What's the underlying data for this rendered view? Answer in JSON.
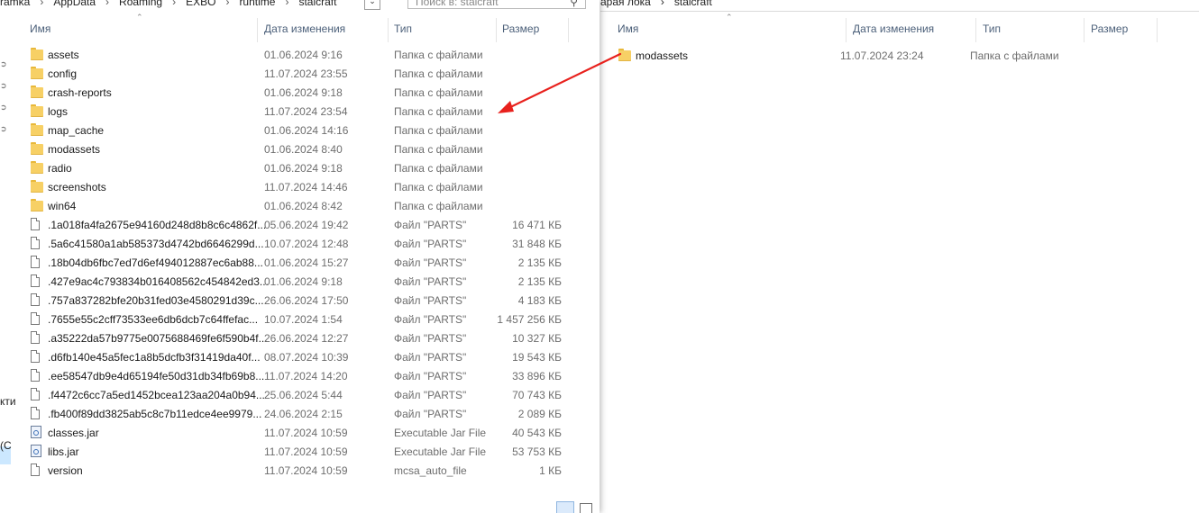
{
  "left": {
    "breadcrumb": [
      "ramka",
      "AppData",
      "Roaming",
      "EXBO",
      "runtime",
      "stalcraft"
    ],
    "search_placeholder": "Поиск в: stalcraft",
    "nav_texts": [
      "кти",
      "(С"
    ],
    "columns": {
      "name": "Имя",
      "date": "Дата изменения",
      "type": "Тип",
      "size": "Размер"
    },
    "rows": [
      {
        "icon": "folder",
        "name": "assets",
        "date": "01.06.2024 9:16",
        "type": "Папка с файлами",
        "size": ""
      },
      {
        "icon": "folder",
        "name": "config",
        "date": "11.07.2024 23:55",
        "type": "Папка с файлами",
        "size": ""
      },
      {
        "icon": "folder",
        "name": "crash-reports",
        "date": "01.06.2024 9:18",
        "type": "Папка с файлами",
        "size": ""
      },
      {
        "icon": "folder",
        "name": "logs",
        "date": "11.07.2024 23:54",
        "type": "Папка с файлами",
        "size": ""
      },
      {
        "icon": "folder",
        "name": "map_cache",
        "date": "01.06.2024 14:16",
        "type": "Папка с файлами",
        "size": ""
      },
      {
        "icon": "folder",
        "name": "modassets",
        "date": "01.06.2024 8:40",
        "type": "Папка с файлами",
        "size": ""
      },
      {
        "icon": "folder",
        "name": "radio",
        "date": "01.06.2024 9:18",
        "type": "Папка с файлами",
        "size": ""
      },
      {
        "icon": "folder",
        "name": "screenshots",
        "date": "11.07.2024 14:46",
        "type": "Папка с файлами",
        "size": ""
      },
      {
        "icon": "folder",
        "name": "win64",
        "date": "01.06.2024 8:42",
        "type": "Папка с файлами",
        "size": ""
      },
      {
        "icon": "file",
        "name": ".1a018fa4fa2675e94160d248d8b8c6c4862f...",
        "date": "05.06.2024 19:42",
        "type": "Файл \"PARTS\"",
        "size": "16 471 КБ"
      },
      {
        "icon": "file",
        "name": ".5a6c41580a1ab585373d4742bd6646299d...",
        "date": "10.07.2024 12:48",
        "type": "Файл \"PARTS\"",
        "size": "31 848 КБ"
      },
      {
        "icon": "file",
        "name": ".18b04db6fbc7ed7d6ef494012887ec6ab88...",
        "date": "01.06.2024 15:27",
        "type": "Файл \"PARTS\"",
        "size": "2 135 КБ"
      },
      {
        "icon": "file",
        "name": ".427e9ac4c793834b016408562c454842ed3...",
        "date": "01.06.2024 9:18",
        "type": "Файл \"PARTS\"",
        "size": "2 135 КБ"
      },
      {
        "icon": "file",
        "name": ".757a837282bfe20b31fed03e4580291d39c...",
        "date": "26.06.2024 17:50",
        "type": "Файл \"PARTS\"",
        "size": "4 183 КБ"
      },
      {
        "icon": "file",
        "name": ".7655e55c2cff73533ee6db6dcb7c64ffefac...",
        "date": "10.07.2024 1:54",
        "type": "Файл \"PARTS\"",
        "size": "1 457 256 КБ"
      },
      {
        "icon": "file",
        "name": ".a35222da57b9775e0075688469fe6f590b4f...",
        "date": "26.06.2024 12:27",
        "type": "Файл \"PARTS\"",
        "size": "10 327 КБ"
      },
      {
        "icon": "file",
        "name": ".d6fb140e45a5fec1a8b5dcfb3f31419da40f...",
        "date": "08.07.2024 10:39",
        "type": "Файл \"PARTS\"",
        "size": "19 543 КБ"
      },
      {
        "icon": "file",
        "name": ".ee58547db9e4d65194fe50d31db34fb69b8...",
        "date": "11.07.2024 14:20",
        "type": "Файл \"PARTS\"",
        "size": "33 896 КБ"
      },
      {
        "icon": "file",
        "name": ".f4472c6cc7a5ed1452bcea123aa204a0b94...",
        "date": "25.06.2024 5:44",
        "type": "Файл \"PARTS\"",
        "size": "70 743 КБ"
      },
      {
        "icon": "file",
        "name": ".fb400f89dd3825ab5c8c7b11edce4ee9979...",
        "date": "24.06.2024 2:15",
        "type": "Файл \"PARTS\"",
        "size": "2 089 КБ"
      },
      {
        "icon": "jar",
        "name": "classes.jar",
        "date": "11.07.2024 10:59",
        "type": "Executable Jar File",
        "size": "40 543 КБ"
      },
      {
        "icon": "jar",
        "name": "libs.jar",
        "date": "11.07.2024 10:59",
        "type": "Executable Jar File",
        "size": "53 753 КБ"
      },
      {
        "icon": "file",
        "name": "version",
        "date": "11.07.2024 10:59",
        "type": "mcsa_auto_file",
        "size": "1 КБ"
      }
    ]
  },
  "right": {
    "breadcrumb": [
      "арая лока",
      "stalcraft"
    ],
    "columns": {
      "name": "Имя",
      "date": "Дата изменения",
      "type": "Тип",
      "size": "Размер"
    },
    "rows": [
      {
        "icon": "folder",
        "name": "modassets",
        "date": "11.07.2024 23:24",
        "type": "Папка с файлами",
        "size": ""
      }
    ]
  },
  "colors": {
    "accent": "#cce8ff",
    "arrow": "#e8211d",
    "header_text": "#4c607a"
  }
}
